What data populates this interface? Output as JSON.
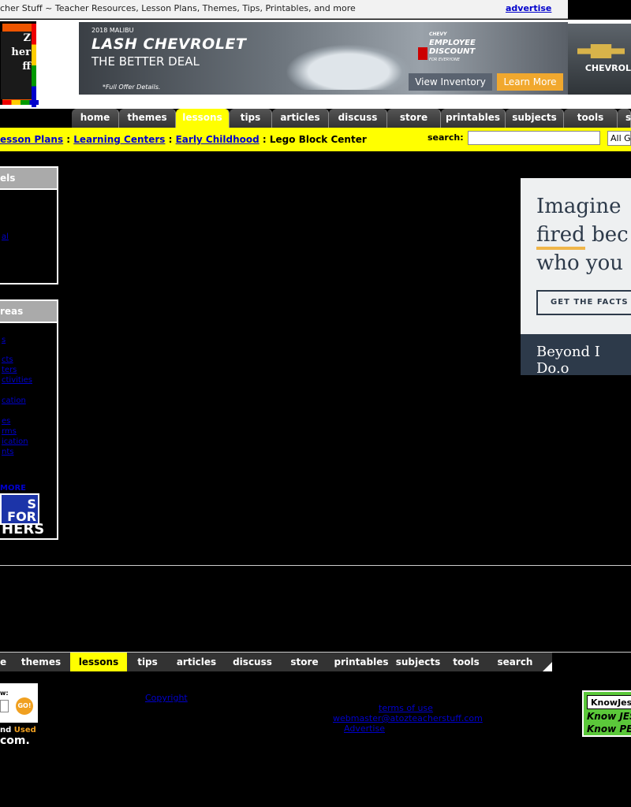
{
  "topbar": {
    "title": "cher Stuff ~ Teacher Resources, Lesson Plans, Themes, Tips, Printables, and more",
    "advertise": "advertise"
  },
  "logo": {
    "text_line1": "Z",
    "text_line2": "her",
    "text_line3": "ff"
  },
  "banner": {
    "small": "2018 MALIBU",
    "headline": "LASH CHEVROLET",
    "sub": "THE BETTER DEAL",
    "fine": "*Full Offer Details.",
    "discount_line1": "CHEVY",
    "discount_line2": "EMPLOYEE",
    "discount_line3": "DISCOUNT",
    "discount_line4": "FOR EVERYONE",
    "view_inventory": "View Inventory",
    "learn_more": "Learn More",
    "brand": "CHEVROL"
  },
  "nav": {
    "tabs": [
      "home",
      "themes",
      "lessons",
      "tips",
      "articles",
      "discuss",
      "store",
      "printables",
      "subjects",
      "tools",
      "s"
    ],
    "active": "lessons"
  },
  "breadcrumb": {
    "c1": "esson Plans",
    "c2": "Learning Centers",
    "c3": "Early Childhood",
    "current": "Lego Block Center",
    "sep": " : "
  },
  "search": {
    "label": "search:",
    "value": "",
    "select": "All G"
  },
  "sidebar1": {
    "title": "els",
    "links": [
      "al"
    ]
  },
  "sidebar2": {
    "title": "reas",
    "links": [
      "s",
      "cts",
      "ters",
      "ctivities",
      "cation",
      "es",
      "rms",
      "ication",
      "nts"
    ],
    "more": "MORE",
    "jobs_line1": "S FOR",
    "jobs_line2": "HERS"
  },
  "ad_right": {
    "line1": "Imagine",
    "line2a": "fired",
    "line2b": " bec",
    "line3": "who you",
    "cta": "GET THE FACTS",
    "footer": "Beyond I Do.o"
  },
  "bottom_nav": {
    "tabs": [
      "e",
      "themes",
      "lessons",
      "tips",
      "articles",
      "discuss",
      "store",
      "printables",
      "subjects",
      "tools",
      "search"
    ],
    "active": "lessons"
  },
  "bookstore": {
    "label": "w:",
    "go": "GO!",
    "line1a": "nd ",
    "line1b": "Used",
    "line2": "com."
  },
  "footer": {
    "copyright": "Copyright",
    "terms": "terms of use",
    "email": "webmaster@atozteacherstuff.com",
    "advertise": "Advertise"
  },
  "knowjesus": {
    "top": "KnowJes",
    "r1": "Know JES",
    "r2": "Know PE"
  }
}
